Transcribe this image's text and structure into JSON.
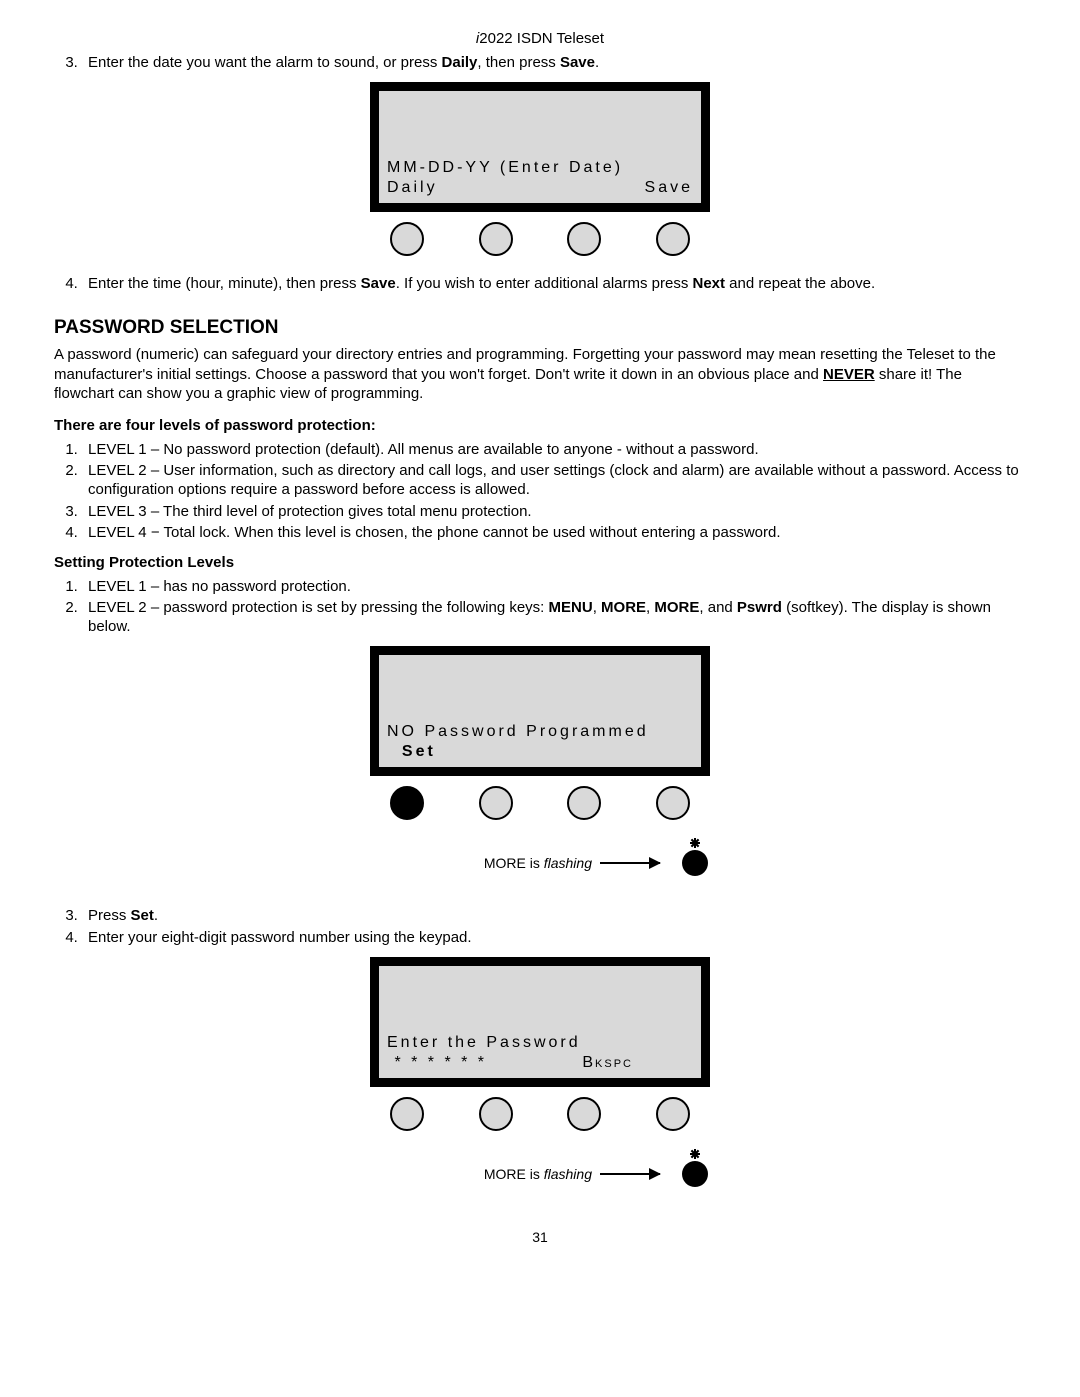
{
  "header": {
    "model_i": "i",
    "model_rest": "2022 ISDN Teleset"
  },
  "step3_text": {
    "pre": "Enter the date you want the alarm to sound, or press ",
    "b1": "Daily",
    "mid": ", then press ",
    "b2": "Save",
    "post": "."
  },
  "lcd1": {
    "line1": "MM-DD-YY  (Enter  Date)",
    "line2_left": "Daily",
    "line2_right": "Save"
  },
  "step4_text": {
    "pre": "Enter the time (hour, minute), then press ",
    "b1": "Save",
    "mid": ". If you wish to enter additional alarms press ",
    "b2": "Next",
    "post": " and repeat the above."
  },
  "section_title": "PASSWORD SELECTION",
  "pwd_intro": {
    "pre": "A password (numeric) can safeguard your directory entries and programming. Forgetting your password may mean resetting the Teleset to the manufacturer's initial settings. Choose a password that you won't forget. Don't write it down in an obvious place and ",
    "never": "NEVER",
    "post": " share it! The flowchart can show you a graphic view of programming."
  },
  "levels_heading": "There are four levels of password protection:",
  "levels": [
    "LEVEL 1 – No password protection (default). All menus are available to anyone - without a password.",
    "LEVEL 2 – User information, such as directory and call logs, and user settings (clock and alarm) are available without a password. Access to configuration options require a password before access is allowed.",
    "LEVEL 3 – The third level of protection gives total menu protection.",
    "LEVEL 4 − Total lock. When this level is chosen, the phone cannot be used without entering a password."
  ],
  "setting_heading": "Setting Protection Levels",
  "setting_steps": {
    "s1": "LEVEL 1 – has no password protection.",
    "s2_pre": "LEVEL 2 – password protection is set by pressing the following keys: ",
    "s2_k1": "MENU",
    "s2_c1": ", ",
    "s2_k2": "MORE",
    "s2_c2": ", ",
    "s2_k3": "MORE",
    "s2_c3": ", and ",
    "s2_k4": "Pswrd",
    "s2_post": " (softkey). The display is shown below."
  },
  "lcd2": {
    "line1": "NO  Password  Programmed",
    "line2_left": "  Set"
  },
  "flash_label_pre": "MORE is ",
  "flash_label_it": "flashing",
  "s3": {
    "pre": "Press ",
    "b": "Set",
    "post": "."
  },
  "s4": "Enter your eight-digit password number using the keypad.",
  "lcd3": {
    "line1": "Enter  the  Password",
    "line2_left": " * * * * * *",
    "line2_right": "Bkspc"
  },
  "page_number": "31"
}
